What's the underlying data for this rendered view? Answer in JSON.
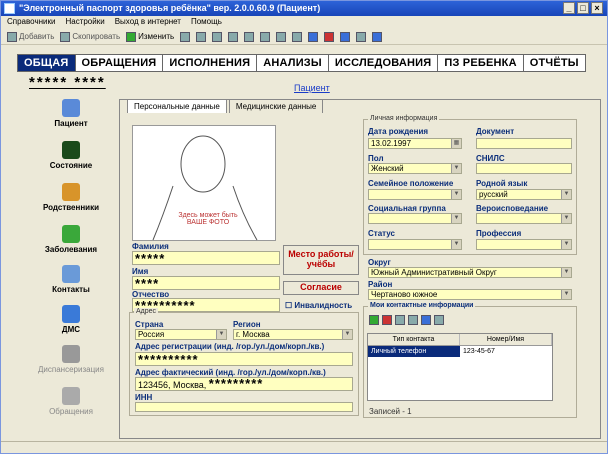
{
  "window": {
    "title": "\"Электронный паспорт здоровья ребёнка\" вер. 2.0.0.60.9 (Пациент)",
    "controls": [
      "_",
      "□",
      "×"
    ]
  },
  "menu": [
    "Справочники",
    "Настройки",
    "Выход в интернет",
    "Помощь"
  ],
  "toolbar": {
    "btn1": "Добавить",
    "btn2": "Скопировать",
    "btn3": "Изменить"
  },
  "main_tabs": [
    "ОБЩАЯ",
    "ОБРАЩЕНИЯ",
    "ИСПОЛНЕНИЯ",
    "АНАЛИЗЫ",
    "ИССЛЕДОВАНИЯ",
    "ПЗ РЕБЕНКА",
    "ОТЧЁТЫ"
  ],
  "masked_name": "***** ****",
  "patient_link": "Пациент",
  "sidebar": [
    "Пациент",
    "Состояние",
    "Родственники",
    "Заболевания",
    "Контакты",
    "ДМС",
    "Диспансеризация",
    "Обращения"
  ],
  "subtabs": [
    "Персональные данные",
    "Медицинские данные"
  ],
  "photo_caption": "Здесь может быть ВАШЕ ФОТО",
  "labels": {
    "surname": "Фамилия",
    "name": "Имя",
    "patronymic": "Отчество",
    "address": "Адрес",
    "country": "Страна",
    "region": "Регион",
    "reg_address": "Адрес регистрации (инд. /гор./ул./дом/корп./кв.)",
    "fact_address": "Адрес фактический (инд. /гор./ул./дом/корп./кв.)",
    "inn": "ИНН",
    "personal_info": "Личная информация",
    "birth_date": "Дата рождения",
    "document": "Документ",
    "sex": "Пол",
    "snils": "СНИЛС",
    "marital": "Семейное положение",
    "native_lang": "Родной язык",
    "social_group": "Социальная группа",
    "religion": "Вероисповедание",
    "status": "Статус",
    "profession": "Профессия",
    "district": "Округ",
    "area": "Район",
    "contact_info": "Мои контактные информации"
  },
  "values": {
    "surname": "*****",
    "name": "****",
    "patronymic": "**********",
    "country": "Россия",
    "region": "г. Москва",
    "reg_address": "**********",
    "fact_address_prefix": "123456, Москва,",
    "fact_address_mask": "*********",
    "birth_date": "13.02.1997",
    "sex": "Женский",
    "native_lang": "русский",
    "district": "Южный Административный Округ",
    "area": "Чертаново южное"
  },
  "buttons": {
    "place": "Место работы/учёбы",
    "consent": "Согласие",
    "disabled": "Инвалидность"
  },
  "contacts_grid": {
    "columns": [
      "Тип контакта",
      "Номер/Имя"
    ],
    "rows": [
      [
        "Личный телефон",
        "123-45-67"
      ]
    ]
  },
  "records": "Записей - 1"
}
